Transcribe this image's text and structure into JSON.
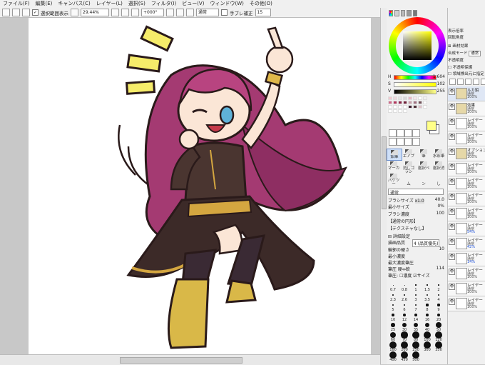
{
  "menu": [
    "ファイル(F)",
    "編集(E)",
    "キャンバス(C)",
    "レイヤー(L)",
    "選択(S)",
    "フィルタ(I)",
    "ビュー(V)",
    "ウィンドウ(W)",
    "その他(O)"
  ],
  "toolbar": {
    "selection_label": "選択範囲表示",
    "zoom_value": "29.44%",
    "rotation_value": "+000°",
    "mode_value": "通常",
    "stabilizer_label": "手ブレ補正",
    "stabilizer_value": "15"
  },
  "color": {
    "current_fg": "#ffff88",
    "current_bg": "#ffffff",
    "H_label": "H",
    "H_value": "1.604",
    "S_label": "S",
    "S_value": "102",
    "V_label": "V",
    "V_value": "255",
    "palette": [
      "#f2c7cf",
      "#ecd6dc",
      "#e4e4e4",
      "#d8d8d8",
      "#e9b8c5",
      "#f5e6ea",
      "#ffffff",
      "#f0f0f0",
      "#d06a8a",
      "#b5385e",
      "#8a2648",
      "#702038",
      "#c9a0aa",
      "#a07080",
      "#705058",
      "#ffffff",
      "#ffffff",
      "#ffffff",
      "#ffffff",
      "#ffffff",
      "#402030",
      "#503038",
      "#e0c0c8",
      "#ffffff",
      "#ffffff",
      "#ffffff",
      "#ffffff",
      "#ffffff"
    ]
  },
  "tools": [
    {
      "label": "鉛筆",
      "selected": true
    },
    {
      "label": "エアブラシ",
      "selected": false
    },
    {
      "label": "筆",
      "selected": false
    },
    {
      "label": "水彩筆",
      "selected": false
    },
    {
      "label": "マーカー",
      "selected": false
    },
    {
      "label": "消しゴム",
      "selected": false
    },
    {
      "label": "選択ペン",
      "selected": false
    },
    {
      "label": "選択消し",
      "selected": false
    },
    {
      "label": "バケツ",
      "selected": false
    }
  ],
  "brush": {
    "blend_mode": "通常",
    "size_label": "ブラシサイズ",
    "size_mult": "x1.0",
    "size_value": "40.0",
    "min_size_label": "最小サイズ",
    "min_size_value": "0%",
    "density_label": "ブラシ濃度",
    "density_value": "100",
    "shape_label": "【通常の円形】",
    "texture_label": "【テクスチャなし】",
    "detail_label": "詳細設定",
    "quality_label": "描画品質",
    "quality_value": "4 (品質優先)",
    "edge_label": "輪郭の硬さ",
    "edge_value": "10",
    "min_density_label": "最小濃度",
    "max_density_label": "最大濃度筆圧",
    "pressure_label": "筆圧 硬⇔軟",
    "pressure_value": "114",
    "pressure2_label": "筆圧:",
    "density_check_label": "濃度",
    "size_check_label": "サイズ"
  },
  "brush_sizes": [
    "0.7",
    "0.8",
    "1",
    "1.5",
    "2",
    "2.3",
    "2.6",
    "3",
    "3.5",
    "4",
    "5",
    "6",
    "7",
    "8",
    "9",
    "10",
    "12",
    "14",
    "16",
    "20",
    "25",
    "30",
    "35",
    "40",
    "50",
    "60",
    "70",
    "80",
    "100",
    "120",
    "160",
    "200",
    "250",
    "300",
    "350",
    "400",
    "450",
    "500"
  ],
  "layer_props": {
    "display_label": "表示倍率",
    "rotation_label": "回転角度",
    "effect_label": "画材効果",
    "mode_label": "合成モード",
    "mode_value": "通常",
    "opacity_label": "不透明度",
    "protect_label": "不透明保護",
    "clip_label": "領域検出元に指定"
  },
  "layers": [
    {
      "name": "ルカ鉛",
      "mode": "通常",
      "opacity": "100%",
      "type": "folder",
      "blue": false
    },
    {
      "name": "効果",
      "mode": "通常",
      "opacity": "100%",
      "type": "folder",
      "blue": false
    },
    {
      "name": "レイヤー",
      "mode": "通常",
      "opacity": "100%",
      "type": "layer",
      "blue": false
    },
    {
      "name": "レイヤー",
      "mode": "通常",
      "opacity": "100%",
      "type": "layer",
      "blue": false
    },
    {
      "name": "オプション",
      "mode": "通常",
      "opacity": "100%",
      "type": "folder",
      "blue": false
    },
    {
      "name": "レイヤー",
      "mode": "通常",
      "opacity": "100%",
      "type": "layer",
      "blue": false
    },
    {
      "name": "レイヤー",
      "mode": "通常",
      "opacity": "100%",
      "type": "layer",
      "blue": false
    },
    {
      "name": "レイヤー",
      "mode": "通常",
      "opacity": "100%",
      "type": "layer",
      "blue": false
    },
    {
      "name": "レイヤー",
      "mode": "通常",
      "opacity": "100%",
      "type": "layer",
      "blue": false
    },
    {
      "name": "レイヤー",
      "mode": "通常",
      "opacity": "54%",
      "type": "layer",
      "blue": true
    },
    {
      "name": "レイヤー",
      "mode": "通常",
      "opacity": "42%",
      "type": "layer",
      "blue": true
    },
    {
      "name": "レイヤー",
      "mode": "通常",
      "opacity": "14%",
      "type": "layer",
      "blue": true
    },
    {
      "name": "レイヤー",
      "mode": "通常",
      "opacity": "100%",
      "type": "layer",
      "blue": false
    },
    {
      "name": "レイヤー",
      "mode": "通常",
      "opacity": "100%",
      "type": "layer",
      "blue": false
    },
    {
      "name": "レイヤー",
      "mode": "通常",
      "opacity": "100%",
      "type": "layer",
      "blue": false
    }
  ]
}
